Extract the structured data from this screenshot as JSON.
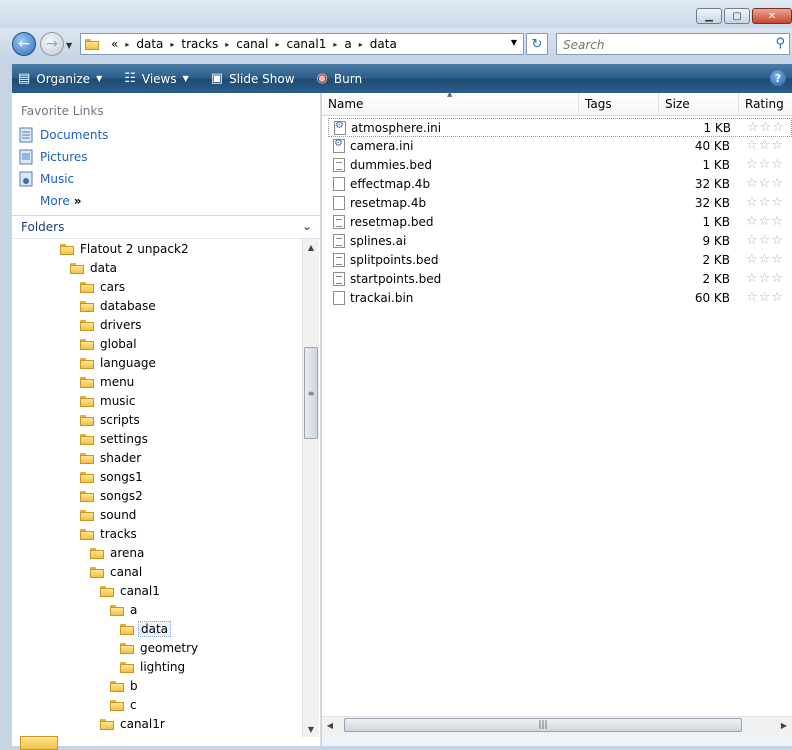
{
  "window": {
    "controls": [
      "minimize",
      "maximize",
      "close"
    ]
  },
  "address": {
    "overflow": "«",
    "crumbs": [
      "data",
      "tracks",
      "canal",
      "canal1",
      "a",
      "data"
    ]
  },
  "search": {
    "placeholder": "Search"
  },
  "toolbar": {
    "organize": "Organize",
    "views": "Views",
    "slideshow": "Slide Show",
    "burn": "Burn"
  },
  "favorites": {
    "title": "Favorite Links",
    "items": [
      {
        "label": "Documents",
        "icon": "documents-icon"
      },
      {
        "label": "Pictures",
        "icon": "pictures-icon"
      },
      {
        "label": "Music",
        "icon": "music-icon"
      }
    ],
    "more": "More"
  },
  "folders": {
    "title": "Folders",
    "tree": [
      {
        "label": "Flatout 2 unpack2",
        "level": 0
      },
      {
        "label": "data",
        "level": 1
      },
      {
        "label": "cars",
        "level": 2
      },
      {
        "label": "database",
        "level": 2
      },
      {
        "label": "drivers",
        "level": 2
      },
      {
        "label": "global",
        "level": 2
      },
      {
        "label": "language",
        "level": 2
      },
      {
        "label": "menu",
        "level": 2
      },
      {
        "label": "music",
        "level": 2
      },
      {
        "label": "scripts",
        "level": 2
      },
      {
        "label": "settings",
        "level": 2
      },
      {
        "label": "shader",
        "level": 2
      },
      {
        "label": "songs1",
        "level": 2
      },
      {
        "label": "songs2",
        "level": 2
      },
      {
        "label": "sound",
        "level": 2
      },
      {
        "label": "tracks",
        "level": 2
      },
      {
        "label": "arena",
        "level": 3
      },
      {
        "label": "canal",
        "level": 3
      },
      {
        "label": "canal1",
        "level": 4
      },
      {
        "label": "a",
        "level": 5
      },
      {
        "label": "data",
        "level": 6,
        "selected": true
      },
      {
        "label": "geometry",
        "level": 6
      },
      {
        "label": "lighting",
        "level": 6
      },
      {
        "label": "b",
        "level": 5
      },
      {
        "label": "c",
        "level": 5
      },
      {
        "label": "canal1r",
        "level": 4
      }
    ]
  },
  "filelist": {
    "columns": {
      "name": "Name",
      "tags": "Tags",
      "size": "Size",
      "rating": "Rating"
    },
    "files": [
      {
        "name": "atmosphere.ini",
        "size": "1 KB",
        "type": "ini",
        "selected": true
      },
      {
        "name": "camera.ini",
        "size": "40 KB",
        "type": "ini"
      },
      {
        "name": "dummies.bed",
        "size": "1 KB",
        "type": "doc"
      },
      {
        "name": "effectmap.4b",
        "size": "32 KB",
        "type": "blank"
      },
      {
        "name": "resetmap.4b",
        "size": "32 KB",
        "type": "blank"
      },
      {
        "name": "resetmap.bed",
        "size": "1 KB",
        "type": "doc"
      },
      {
        "name": "splines.ai",
        "size": "9 KB",
        "type": "doc"
      },
      {
        "name": "splitpoints.bed",
        "size": "2 KB",
        "type": "doc"
      },
      {
        "name": "startpoints.bed",
        "size": "2 KB",
        "type": "doc"
      },
      {
        "name": "trackai.bin",
        "size": "60 KB",
        "type": "blank"
      }
    ]
  }
}
